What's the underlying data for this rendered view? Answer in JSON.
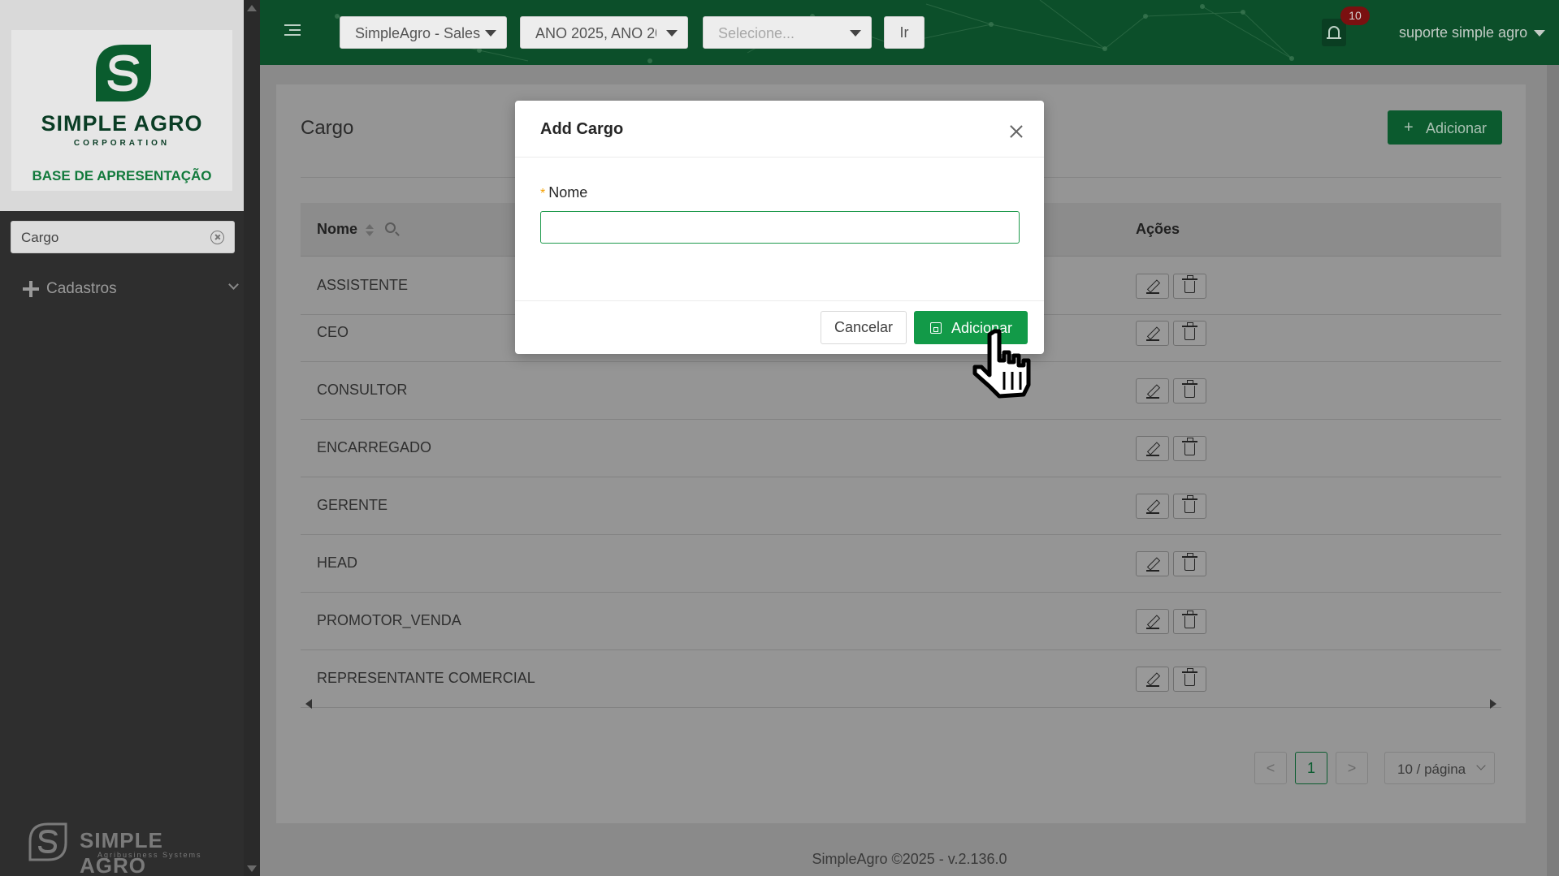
{
  "sidebar": {
    "brand_name": "SIMPLE AGRO",
    "brand_sub": "CORPORATION",
    "base_label": "BASE DE APRESENTAÇÃO",
    "search_value": "Cargo",
    "menu": [
      {
        "label": "Cadastros"
      }
    ],
    "footer_brand": "SIMPLE AGRO",
    "footer_sub": "Agribusiness Systems"
  },
  "header": {
    "company_select": "SimpleAgro - Sales",
    "year_select": "ANO 2025, ANO 202",
    "third_select_placeholder": "Selecione...",
    "go_label": "Ir",
    "notification_count": "10",
    "user_name": "suporte simple agro"
  },
  "page": {
    "title": "Cargo",
    "add_label": "Adicionar",
    "table": {
      "columns": [
        "Nome",
        "Ações"
      ],
      "rows": [
        {
          "nome": "ASSISTENTE"
        },
        {
          "nome": "CEO"
        },
        {
          "nome": "CONSULTOR"
        },
        {
          "nome": "ENCARREGADO"
        },
        {
          "nome": "GERENTE"
        },
        {
          "nome": "HEAD"
        },
        {
          "nome": "PROMOTOR_VENDA"
        },
        {
          "nome": "REPRESENTANTE COMERCIAL"
        }
      ]
    },
    "pagination": {
      "prev": "<",
      "current_page": "1",
      "next": ">",
      "page_size": "10 / página"
    }
  },
  "footer": {
    "text": "SimpleAgro ©2025 - v.2.136.0"
  },
  "modal": {
    "title": "Add Cargo",
    "field_required_mark": "*",
    "field_label": "Nome",
    "field_value": "",
    "cancel_label": "Cancelar",
    "submit_label": "Adicionar"
  },
  "colors": {
    "brand_green": "#0c4f2a",
    "button_green": "#129a48",
    "input_focus": "#1e9a4c",
    "badge_red": "#7a1010"
  },
  "icons": [
    "menu-icon",
    "chevron-down-icon",
    "bell-icon",
    "plus-icon",
    "sort-icon",
    "search-icon",
    "edit-icon",
    "trash-icon",
    "close-icon",
    "save-icon",
    "clear-icon",
    "hand-pointer-icon"
  ]
}
